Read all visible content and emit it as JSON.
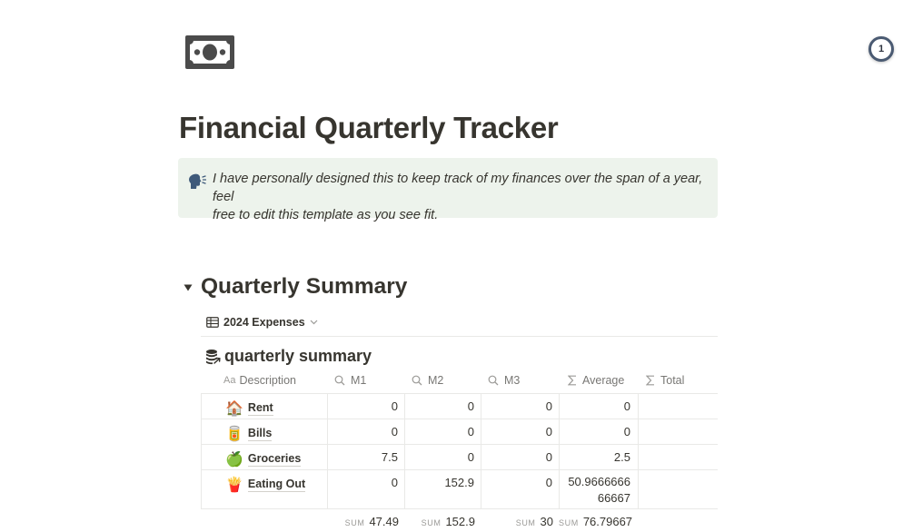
{
  "badge": {
    "count": "1"
  },
  "page": {
    "title": "Financial Quarterly Tracker"
  },
  "callout": {
    "line1": "I have personally designed this to keep track of my finances over the span of a year, feel",
    "line2": "free to edit this template as you see fit."
  },
  "section": {
    "heading": "Quarterly Summary"
  },
  "view": {
    "label": "2024 Expenses"
  },
  "database": {
    "title": "quarterly summary",
    "columns": {
      "description": "Description",
      "description_prefix": "Aa",
      "m1": "M1",
      "m2": "M2",
      "m3": "M3",
      "average": "Average",
      "total": "Total"
    },
    "rows": [
      {
        "emoji": "🏠",
        "name": "Rent",
        "m1": "0",
        "m2": "0",
        "m3": "0",
        "average": "0",
        "average_cont": "",
        "total": ""
      },
      {
        "emoji": "🥫",
        "name": "Bills",
        "m1": "0",
        "m2": "0",
        "m3": "0",
        "average": "0",
        "average_cont": "",
        "total": ""
      },
      {
        "emoji": "🍏",
        "name": "Groceries",
        "m1": "7.5",
        "m2": "0",
        "m3": "0",
        "average": "2.5",
        "average_cont": "",
        "total": ""
      },
      {
        "emoji": "🍟",
        "name": "Eating Out",
        "m1": "0",
        "m2": "152.9",
        "m3": "0",
        "average": "50.9666666",
        "average_cont": "66667",
        "total": ""
      }
    ],
    "sums": {
      "label": "SUM",
      "m1": "47.49",
      "m2": "152.9",
      "m3": "30",
      "average": "76.79667"
    }
  },
  "icons": {
    "page_icon": "dollar-bill-icon",
    "callout_icon": "speaking-head-icon",
    "toggle": "triangle-down-icon",
    "table_view": "table-icon",
    "view_dropdown": "chevron-down-icon",
    "db_icon": "coins-icon",
    "search_column": "search-icon",
    "formula_column": "sigma-icon"
  }
}
